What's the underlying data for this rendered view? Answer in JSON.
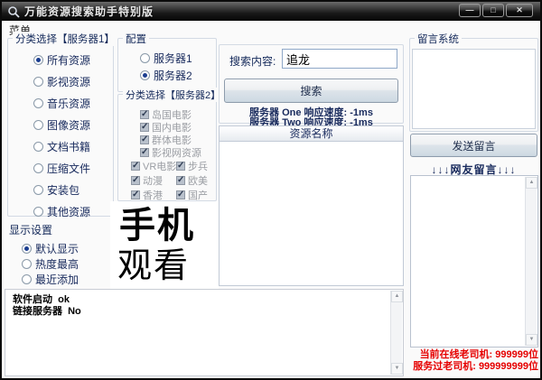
{
  "window": {
    "title": "万能资源搜索助手特别版",
    "controls": {
      "minimize_glyph": "—",
      "maximize_glyph": "□",
      "close_glyph": "✕"
    }
  },
  "menu": {
    "items": [
      {
        "label": "菜单"
      }
    ]
  },
  "server1_group": {
    "title": "分类选择【服务器1】",
    "items": [
      {
        "label": "所有资源",
        "selected": true
      },
      {
        "label": "影视资源",
        "selected": false
      },
      {
        "label": "音乐资源",
        "selected": false
      },
      {
        "label": "图像资源",
        "selected": false
      },
      {
        "label": "文档书籍",
        "selected": false
      },
      {
        "label": "压缩文件",
        "selected": false
      },
      {
        "label": "安装包",
        "selected": false
      },
      {
        "label": "其他资源",
        "selected": false
      }
    ]
  },
  "display_group": {
    "title": "显示设置",
    "items": [
      {
        "label": "默认显示",
        "selected": true
      },
      {
        "label": "热度最高",
        "selected": false
      },
      {
        "label": "最近添加",
        "selected": false
      }
    ]
  },
  "config_group": {
    "title": "配置",
    "items": [
      {
        "label": "服务器1",
        "selected": false
      },
      {
        "label": "服务器2",
        "selected": true
      }
    ]
  },
  "server2_group": {
    "title": "分类选择【服务器2】",
    "all_checked": true,
    "full_items": [
      "岛国电影",
      "国内电影",
      "群体电影",
      "影视网资源"
    ],
    "pair_items": [
      [
        "VR电影",
        "步兵"
      ],
      [
        "动漫",
        "欧美"
      ],
      [
        "香港",
        "国产"
      ]
    ]
  },
  "ad_box": {
    "line1": "手机",
    "line2": "观看"
  },
  "search": {
    "label": "搜索内容:",
    "value": "追龙",
    "button": "搜索",
    "speed1": "服务器 One 响应速度: -1ms",
    "speed2": "服务器 Two 响应速度: -1ms"
  },
  "results": {
    "header": "资源名称"
  },
  "message": {
    "group_title": "留言系统",
    "send_button": "发送留言",
    "friends_label": "↓↓↓网友留言↓↓↓"
  },
  "stats": {
    "online": "当前在线老司机: 999999位",
    "served": "服务过老司机: 999999999位",
    "color": "#e60000"
  },
  "log": {
    "text": "软件启动  ok\n链接服务器  No"
  }
}
